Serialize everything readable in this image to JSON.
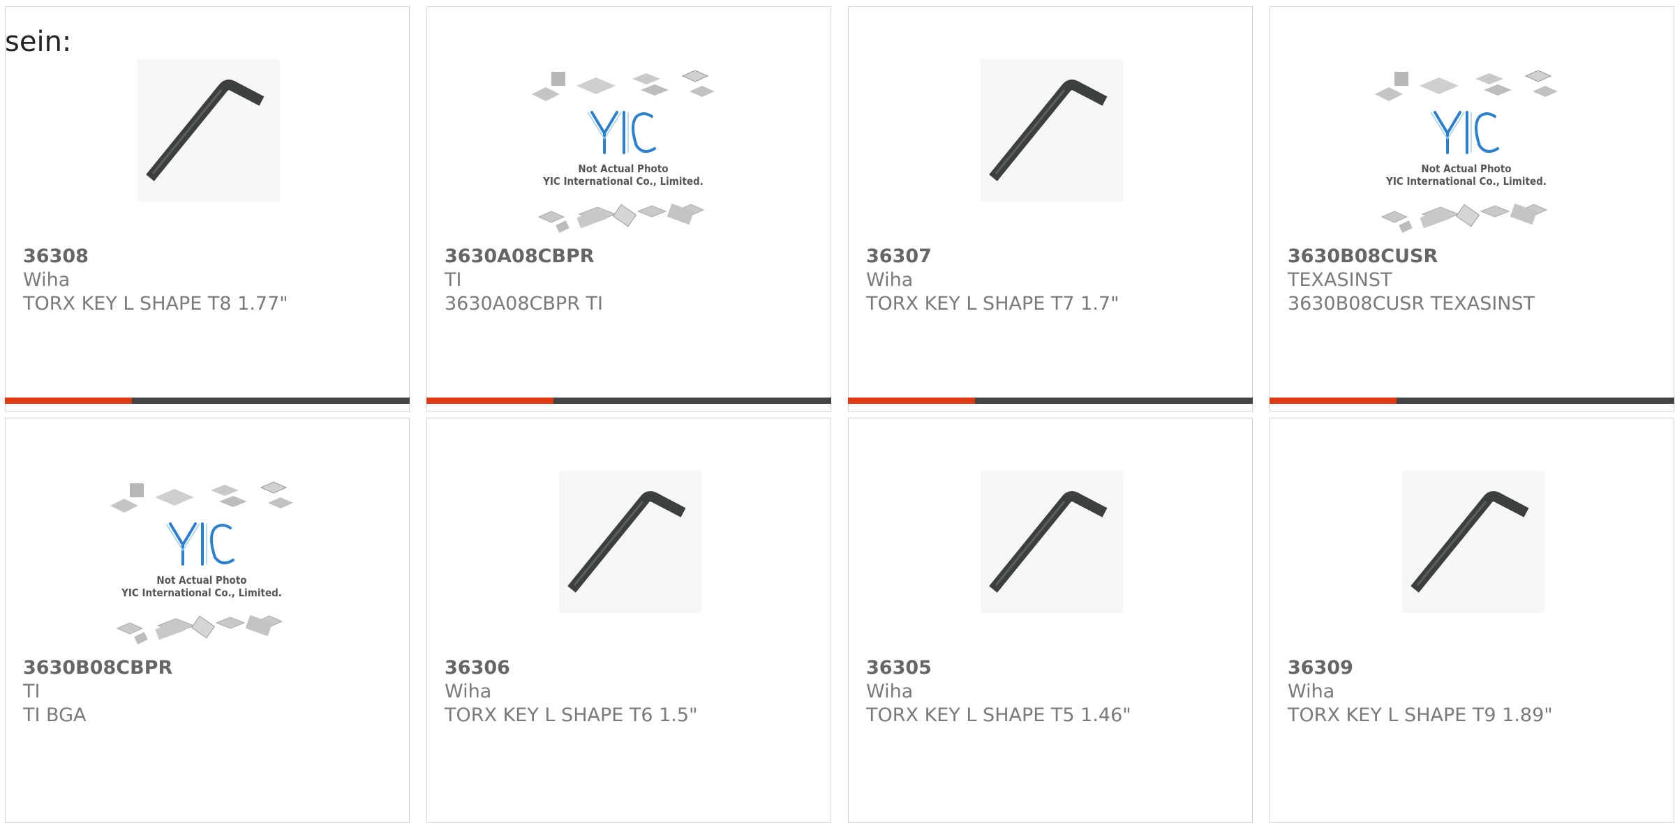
{
  "lead_text": "sein:",
  "colors": {
    "accent": "#e03a12",
    "bar": "#444444",
    "border": "#d4d4d4",
    "text": "#7a7a7a"
  },
  "placeholder": {
    "line1": "Not Actual Photo",
    "line2": "YIC International Co., Limited.",
    "logo": "YIC"
  },
  "products": [
    {
      "part": "36308",
      "maker": "Wiha",
      "desc": "TORX KEY L SHAPE T8 1.77\"",
      "image": "hex-key-icon",
      "has_bar": true
    },
    {
      "part": "3630A08CBPR",
      "maker": "TI",
      "desc": "3630A08CBPR TI",
      "image": "not-actual-photo",
      "has_bar": true
    },
    {
      "part": "36307",
      "maker": "Wiha",
      "desc": "TORX KEY L SHAPE T7 1.7\"",
      "image": "hex-key-icon",
      "has_bar": true
    },
    {
      "part": "3630B08CUSR",
      "maker": "TEXASINST",
      "desc": "3630B08CUSR TEXASINST",
      "image": "not-actual-photo",
      "has_bar": true
    },
    {
      "part": "3630B08CBPR",
      "maker": "TI",
      "desc": "TI BGA",
      "image": "not-actual-photo",
      "has_bar": false
    },
    {
      "part": "36306",
      "maker": "Wiha",
      "desc": "TORX KEY L SHAPE T6 1.5\"",
      "image": "hex-key-icon",
      "has_bar": false
    },
    {
      "part": "36305",
      "maker": "Wiha",
      "desc": "TORX KEY L SHAPE T5 1.46\"",
      "image": "hex-key-icon",
      "has_bar": false
    },
    {
      "part": "36309",
      "maker": "Wiha",
      "desc": "TORX KEY L SHAPE T9 1.89\"",
      "image": "hex-key-icon",
      "has_bar": false
    }
  ]
}
